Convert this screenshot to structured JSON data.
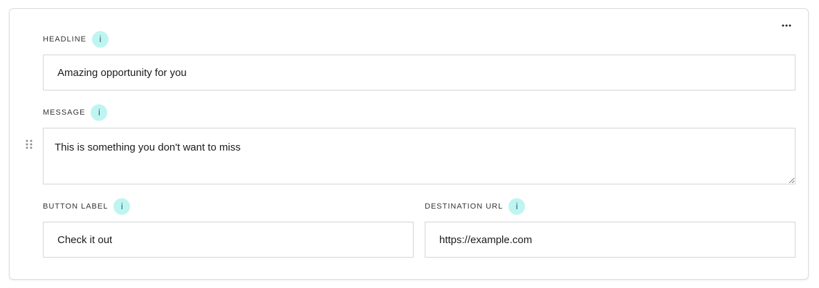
{
  "form": {
    "headline": {
      "label": "HEADLINE",
      "value": "Amazing opportunity for you"
    },
    "message": {
      "label": "MESSAGE",
      "value": "This is something you don't want to miss"
    },
    "button_label": {
      "label": "BUTTON LABEL",
      "value": "Check it out"
    },
    "destination_url": {
      "label": "DESTINATION URL",
      "value": "https://example.com"
    }
  },
  "icons": {
    "info": "i",
    "more": "more-horizontal-icon",
    "drag": "drag-handle-icon"
  },
  "colors": {
    "info_badge_bg": "#bff5f1",
    "border": "#d4d4d4"
  }
}
